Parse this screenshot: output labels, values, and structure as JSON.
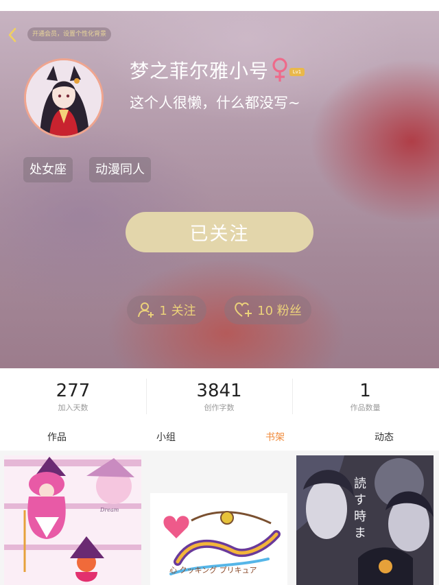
{
  "header": {
    "vip_banner": "开通会员，设置个性化背景"
  },
  "profile": {
    "name": "梦之菲尔雅小号",
    "level": "Lv1",
    "bio": "这个人很懒，什么都没写~",
    "tags": [
      "处女座",
      "动漫同人"
    ],
    "follow_button": "已关注",
    "following": "1 关注",
    "fans": "10 粉丝"
  },
  "stats": [
    {
      "value": "277",
      "label": "加入天数"
    },
    {
      "value": "3841",
      "label": "创作字数"
    },
    {
      "value": "1",
      "label": "作品数量"
    }
  ],
  "tabs": [
    {
      "label": "作品"
    },
    {
      "label": "小组"
    },
    {
      "label": "书架",
      "active": true
    },
    {
      "label": "动态"
    }
  ],
  "shelf": {
    "covers": [
      {
        "text": "Dream"
      },
      {
        "text": "心 クッキング プリキュア"
      },
      {
        "text": "読 す 時 ま"
      }
    ]
  },
  "colors": {
    "accent": "#f08a3a",
    "gold": "#ecd27a",
    "follow_button_bg": "#e3d6ab",
    "level_badge": "#e9b84b"
  }
}
